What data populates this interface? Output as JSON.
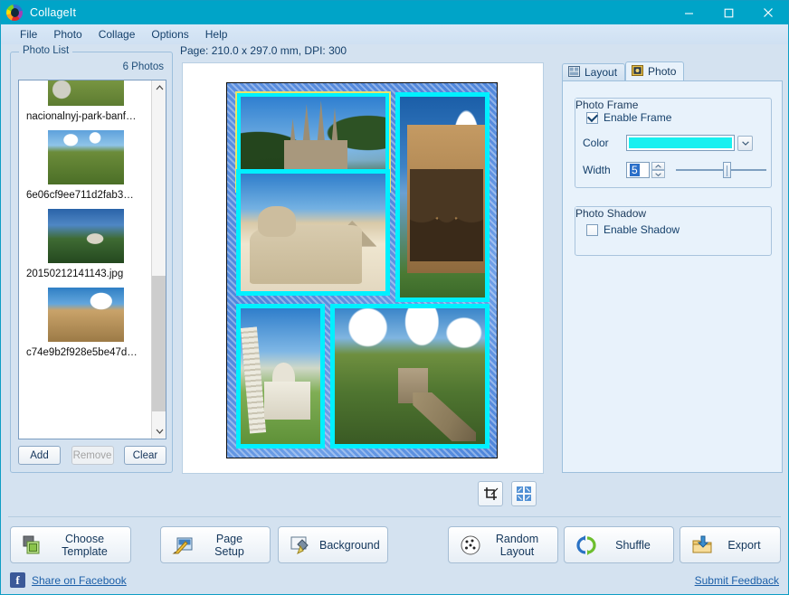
{
  "window": {
    "title": "CollageIt",
    "app_icon": "collageit-logo-icon",
    "controls": {
      "minimize": "minimize-icon",
      "maximize": "maximize-icon",
      "close": "close-icon"
    }
  },
  "menubar": {
    "items": [
      {
        "label": "File"
      },
      {
        "label": "Photo"
      },
      {
        "label": "Collage"
      },
      {
        "label": "Options"
      },
      {
        "label": "Help"
      }
    ]
  },
  "photo_list": {
    "legend": "Photo List",
    "count_label": "6 Photos",
    "items": [
      {
        "name": "nacionalnyj-park-banf…",
        "thumb": "banff-national-park-thumb"
      },
      {
        "name": "6e06cf9ee711d2fab3…",
        "thumb": "great-wall-thumb"
      },
      {
        "name": "20150212141143.jpg",
        "thumb": "mountain-road-thumb"
      },
      {
        "name": "c74e9b2f928e5be47d…",
        "thumb": "colosseum-thumb"
      }
    ],
    "buttons": {
      "add": "Add",
      "remove": "Remove",
      "clear": "Clear"
    },
    "scrollbar": {
      "up_arrow": "chevron-up-icon",
      "down_arrow": "chevron-down-icon"
    }
  },
  "canvas": {
    "page_info": "Page: 210.0 x 297.0 mm, DPI: 300",
    "tools": [
      {
        "name": "crop-tool-button",
        "icon": "crop-icon"
      },
      {
        "name": "auto-arrange-button",
        "icon": "arrange-four-corners-icon"
      }
    ],
    "collage": {
      "background": "blue-denim-pattern",
      "frame_color": "#00f0ff",
      "selected_cell": "sagrada-familia",
      "cells": [
        {
          "id": "sagrada-familia",
          "photo": "sagrada-familia-barcelona",
          "selected": true
        },
        {
          "id": "colosseum",
          "photo": "colosseum-rome",
          "selected": false
        },
        {
          "id": "sphinx",
          "photo": "great-sphinx-giza",
          "selected": false
        },
        {
          "id": "pisa",
          "photo": "leaning-tower-of-pisa",
          "selected": false
        },
        {
          "id": "great-wall",
          "photo": "great-wall-of-china",
          "selected": false
        }
      ]
    }
  },
  "right_panel": {
    "tabs": [
      {
        "label": "Layout",
        "icon": "layout-grid-icon",
        "active": false
      },
      {
        "label": "Photo",
        "icon": "photo-frame-icon",
        "active": true
      }
    ],
    "photo_frame": {
      "legend": "Photo Frame",
      "enable_label": "Enable Frame",
      "enabled": true,
      "color_label": "Color",
      "color_value": "#19f0f0",
      "width_label": "Width",
      "width_value": "5",
      "dropdown_icon": "chevron-down-icon"
    },
    "photo_shadow": {
      "legend": "Photo Shadow",
      "enable_label": "Enable Shadow",
      "enabled": false
    }
  },
  "bottom_toolbar": {
    "buttons": [
      {
        "label": "Choose Template",
        "icon": "template-stack-icon"
      },
      {
        "label": "Page Setup",
        "icon": "page-setup-pencil-icon"
      },
      {
        "label": "Background",
        "icon": "background-brush-icon"
      },
      {
        "label": "Random Layout",
        "icon": "dice-icon"
      },
      {
        "label": "Shuffle",
        "icon": "shuffle-arrows-icon"
      },
      {
        "label": "Export",
        "icon": "export-folder-download-icon"
      }
    ],
    "facebook_link": "Share on Facebook",
    "facebook_icon": "facebook-icon",
    "feedback_link": "Submit Feedback"
  }
}
